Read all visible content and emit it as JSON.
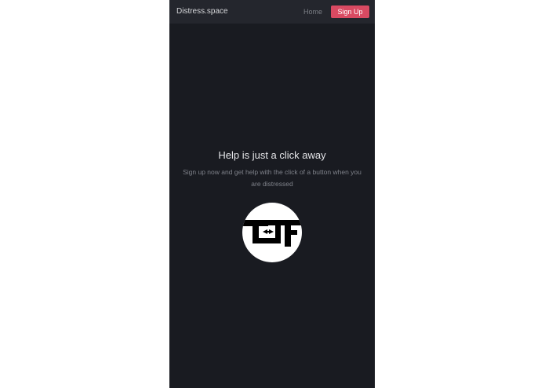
{
  "navbar": {
    "brand": "Distress.space",
    "home_label": "Home",
    "signup_label": "Sign Up"
  },
  "hero": {
    "headline": "Help is just a click away",
    "subtext": "Sign up now and get help with the click of a button when you are distressed",
    "logo_icon": "tef-logo-icon"
  },
  "colors": {
    "page_background": "#ffffff",
    "app_background": "#191b21",
    "navbar_background": "#24262d",
    "accent": "#d94a62"
  }
}
